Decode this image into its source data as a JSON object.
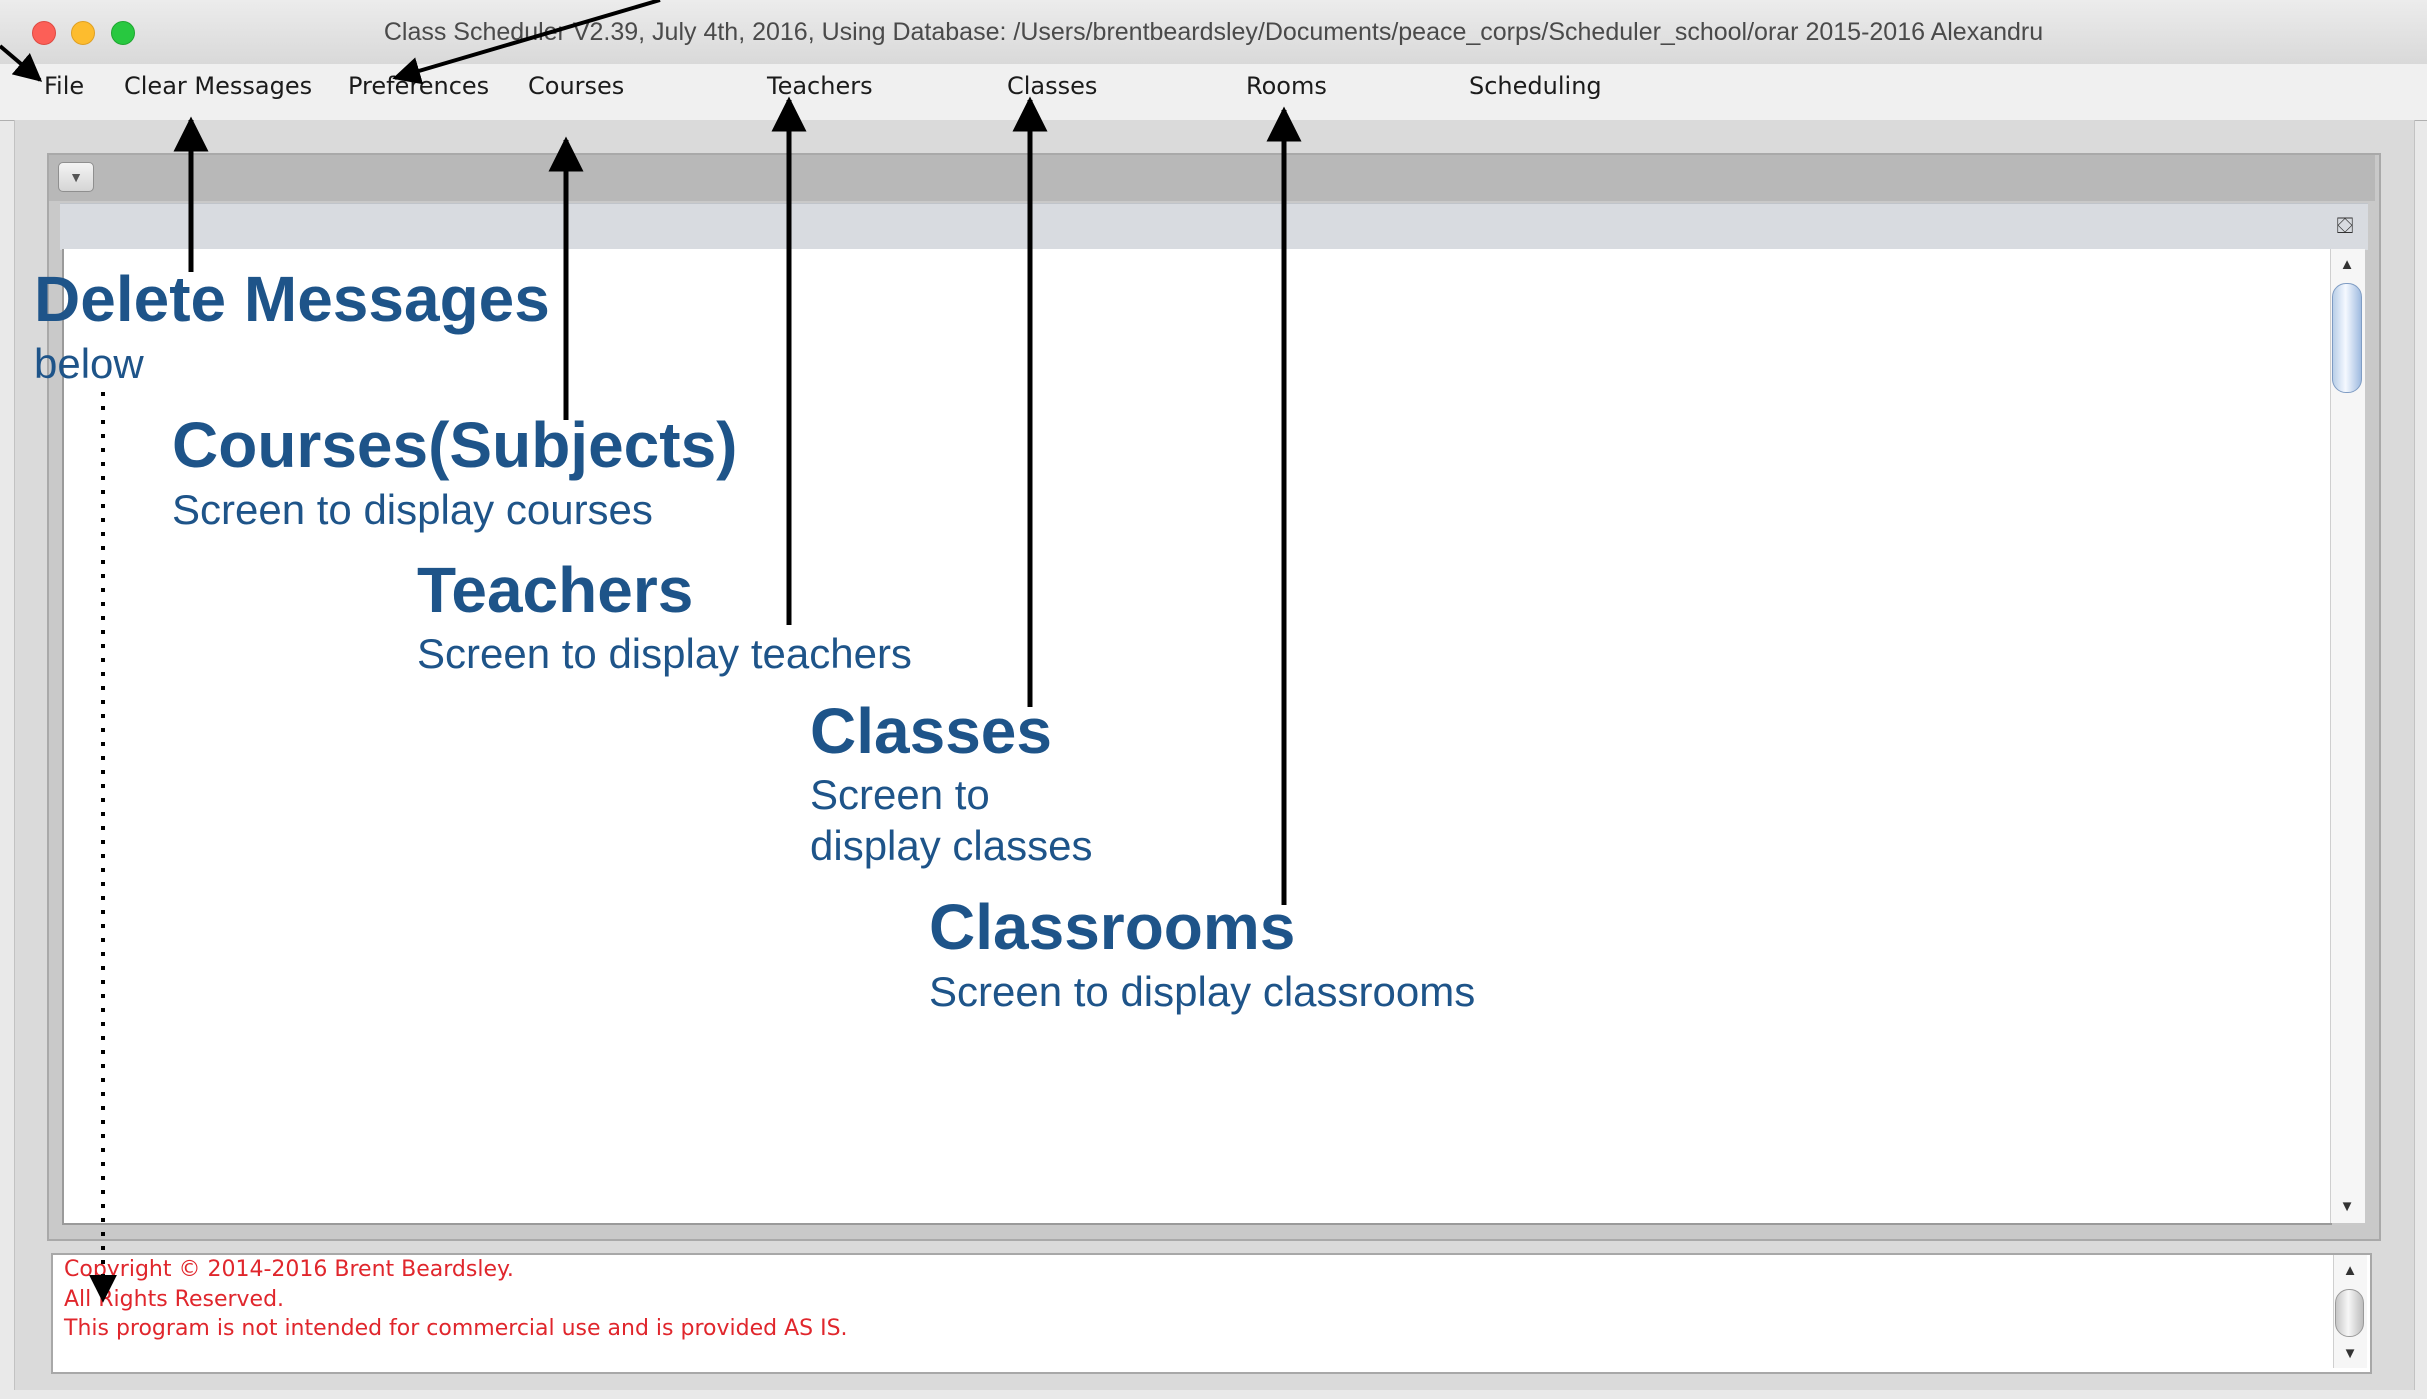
{
  "window": {
    "title": "Class Scheduler V2.39, July 4th, 2016, Using Database: /Users/brentbeardsley/Documents/peace_corps/Scheduler_school/orar 2015-2016 Alexandru"
  },
  "menubar": {
    "items": [
      {
        "label": "File"
      },
      {
        "label": "Clear Messages"
      },
      {
        "label": "Preferences"
      },
      {
        "label": "Courses"
      },
      {
        "label": "Teachers"
      },
      {
        "label": "Classes"
      },
      {
        "label": "Rooms"
      },
      {
        "label": "Scheduling"
      }
    ]
  },
  "messages": {
    "lines": [
      "Copyright © 2014-2016 Brent Beardsley.",
      "All Rights Reserved.",
      "This program is not intended for commercial use and is provided AS IS."
    ],
    "color": "#e0262c"
  },
  "annotations": {
    "color": "#1e5489",
    "delete_messages": {
      "heading": "Delete Messages",
      "sub": "below"
    },
    "courses": {
      "heading": "Courses(Subjects)",
      "sub": "Screen to display courses"
    },
    "teachers": {
      "heading": "Teachers",
      "sub": "Screen to display teachers"
    },
    "classes": {
      "heading": "Classes",
      "sub_line1": "Screen to",
      "sub_line2": "display classes"
    },
    "classrooms": {
      "heading": "Classrooms",
      "sub": "Screen to display classrooms"
    }
  },
  "icons": {
    "collapse": "chevron-down-icon",
    "desktop": "desktop-icon",
    "scroll_up": "scroll-up-arrow-icon",
    "scroll_down": "scroll-down-arrow-icon"
  }
}
